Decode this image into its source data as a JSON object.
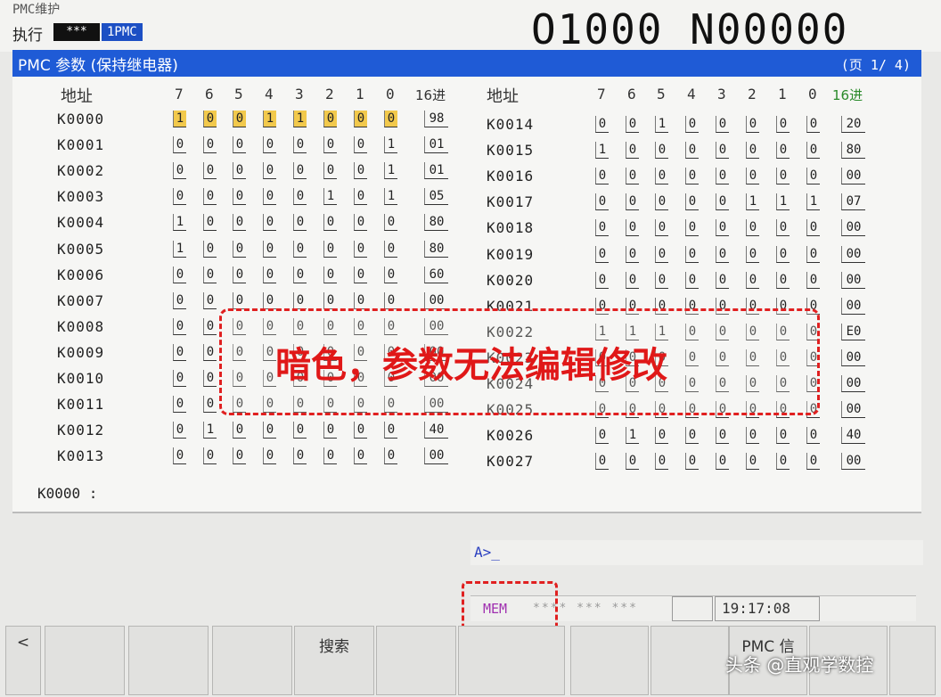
{
  "header": {
    "title": "PMC维护",
    "mode": "执行",
    "mode_stars": "***",
    "mode_path": "1PMC",
    "program": "O1000 N00000"
  },
  "screen": {
    "title": "PMC 参数 (保持继电器)",
    "page": "(页 1/ 4)"
  },
  "columns": {
    "addr": "地址",
    "bits": [
      "7",
      "6",
      "5",
      "4",
      "3",
      "2",
      "1",
      "0"
    ],
    "hex": "16进"
  },
  "rows_left": [
    {
      "addr": "K0000",
      "bits": [
        "1",
        "0",
        "0",
        "1",
        "1",
        "0",
        "0",
        "0"
      ],
      "hex": "98"
    },
    {
      "addr": "K0001",
      "bits": [
        "0",
        "0",
        "0",
        "0",
        "0",
        "0",
        "0",
        "1"
      ],
      "hex": "01"
    },
    {
      "addr": "K0002",
      "bits": [
        "0",
        "0",
        "0",
        "0",
        "0",
        "0",
        "0",
        "1"
      ],
      "hex": "01"
    },
    {
      "addr": "K0003",
      "bits": [
        "0",
        "0",
        "0",
        "0",
        "0",
        "1",
        "0",
        "1"
      ],
      "hex": "05"
    },
    {
      "addr": "K0004",
      "bits": [
        "1",
        "0",
        "0",
        "0",
        "0",
        "0",
        "0",
        "0"
      ],
      "hex": "80"
    },
    {
      "addr": "K0005",
      "bits": [
        "1",
        "0",
        "0",
        "0",
        "0",
        "0",
        "0",
        "0"
      ],
      "hex": "80"
    },
    {
      "addr": "K0006",
      "bits": [
        "0",
        "0",
        "0",
        "0",
        "0",
        "0",
        "0",
        "0"
      ],
      "hex": "60"
    },
    {
      "addr": "K0007",
      "bits": [
        "0",
        "0",
        "0",
        "0",
        "0",
        "0",
        "0",
        "0"
      ],
      "hex": "00"
    },
    {
      "addr": "K0008",
      "bits": [
        "0",
        "0",
        "0",
        "0",
        "0",
        "0",
        "0",
        "0"
      ],
      "hex": "00"
    },
    {
      "addr": "K0009",
      "bits": [
        "0",
        "0",
        "0",
        "0",
        "0",
        "0",
        "0",
        "0"
      ],
      "hex": "00"
    },
    {
      "addr": "K0010",
      "bits": [
        "0",
        "0",
        "0",
        "0",
        "0",
        "0",
        "0",
        "0"
      ],
      "hex": "00"
    },
    {
      "addr": "K0011",
      "bits": [
        "0",
        "0",
        "0",
        "0",
        "0",
        "0",
        "0",
        "0"
      ],
      "hex": "00"
    },
    {
      "addr": "K0012",
      "bits": [
        "0",
        "1",
        "0",
        "0",
        "0",
        "0",
        "0",
        "0"
      ],
      "hex": "40"
    },
    {
      "addr": "K0013",
      "bits": [
        "0",
        "0",
        "0",
        "0",
        "0",
        "0",
        "0",
        "0"
      ],
      "hex": "00"
    }
  ],
  "rows_right": [
    {
      "addr": "K0014",
      "bits": [
        "0",
        "0",
        "1",
        "0",
        "0",
        "0",
        "0",
        "0"
      ],
      "hex": "20"
    },
    {
      "addr": "K0015",
      "bits": [
        "1",
        "0",
        "0",
        "0",
        "0",
        "0",
        "0",
        "0"
      ],
      "hex": "80"
    },
    {
      "addr": "K0016",
      "bits": [
        "0",
        "0",
        "0",
        "0",
        "0",
        "0",
        "0",
        "0"
      ],
      "hex": "00"
    },
    {
      "addr": "K0017",
      "bits": [
        "0",
        "0",
        "0",
        "0",
        "0",
        "1",
        "1",
        "1"
      ],
      "hex": "07"
    },
    {
      "addr": "K0018",
      "bits": [
        "0",
        "0",
        "0",
        "0",
        "0",
        "0",
        "0",
        "0"
      ],
      "hex": "00"
    },
    {
      "addr": "K0019",
      "bits": [
        "0",
        "0",
        "0",
        "0",
        "0",
        "0",
        "0",
        "0"
      ],
      "hex": "00"
    },
    {
      "addr": "K0020",
      "bits": [
        "0",
        "0",
        "0",
        "0",
        "0",
        "0",
        "0",
        "0"
      ],
      "hex": "00"
    },
    {
      "addr": "K0021",
      "bits": [
        "0",
        "0",
        "0",
        "0",
        "0",
        "0",
        "0",
        "0"
      ],
      "hex": "00"
    },
    {
      "addr": "K0022",
      "bits": [
        "1",
        "1",
        "1",
        "0",
        "0",
        "0",
        "0",
        "0"
      ],
      "hex": "E0"
    },
    {
      "addr": "K0023",
      "bits": [
        "0",
        "0",
        "0",
        "0",
        "0",
        "0",
        "0",
        "0"
      ],
      "hex": "00"
    },
    {
      "addr": "K0024",
      "bits": [
        "0",
        "0",
        "0",
        "0",
        "0",
        "0",
        "0",
        "0"
      ],
      "hex": "00"
    },
    {
      "addr": "K0025",
      "bits": [
        "0",
        "0",
        "0",
        "0",
        "0",
        "0",
        "0",
        "0"
      ],
      "hex": "00"
    },
    {
      "addr": "K0026",
      "bits": [
        "0",
        "1",
        "0",
        "0",
        "0",
        "0",
        "0",
        "0"
      ],
      "hex": "40"
    },
    {
      "addr": "K0027",
      "bits": [
        "0",
        "0",
        "0",
        "0",
        "0",
        "0",
        "0",
        "0"
      ],
      "hex": "00"
    }
  ],
  "cursor_line": "K0000 :",
  "annotation": "暗色，参数无法编辑修改",
  "command_prompt": "A>_",
  "status": {
    "mode": "MEM",
    "stars": "**** *** ***",
    "time": "19:17:08"
  },
  "softkeys": [
    "<",
    "",
    "",
    "",
    "搜索",
    "",
    "",
    "",
    "",
    "PMC 信",
    "",
    ""
  ],
  "watermark": "头条 @直观学数控"
}
